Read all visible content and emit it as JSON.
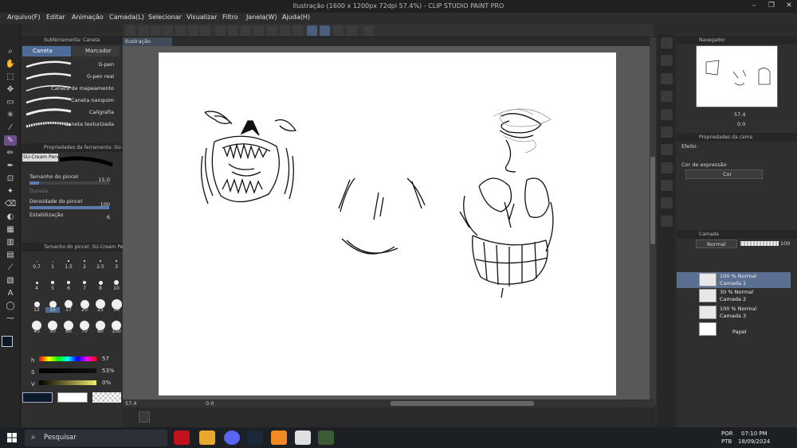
{
  "window": {
    "title": "Ilustração (1600 x 1200px 72dpi 57.4%) - CLIP STUDIO PAINT PRO"
  },
  "menu": [
    "Arquivo(F)",
    "Editar",
    "Animação",
    "Camada(L)",
    "Selecionar",
    "Visualizar",
    "Filtro",
    "Janela(W)",
    "Ajuda(H)"
  ],
  "subtool": {
    "header": "Subferramenta: Caneta",
    "tabs": [
      "Caneta",
      "Marcador"
    ],
    "brushes": [
      "G-pen",
      "G-pen real",
      "Caneta de mapeamento",
      "Caneta nanquim",
      "Caligrafia",
      "Caneta texturizada"
    ]
  },
  "toolprops": {
    "header": "Propriedades da ferramenta: SU-C...",
    "brush_name": "SU-Cream Pencil",
    "size_label": "Tamanho do pincel",
    "size_value": "15.0",
    "hardness_label": "Dureza",
    "density_label": "Densidade do pincel",
    "density_value": "100",
    "stabilization_label": "Estabilização",
    "stabilization_value": "6"
  },
  "brushsize": {
    "header": "Tamanho do pincel: SU-Cream Penci",
    "row1": [
      "0.7",
      "1",
      "1.5",
      "2",
      "2.5",
      "3"
    ],
    "row2": [
      "4",
      "5",
      "6",
      "7",
      "8",
      "10"
    ],
    "row3": [
      "12",
      "15",
      "17",
      "20",
      "25",
      "30"
    ],
    "row4": [
      "40",
      "50",
      "60",
      "70",
      "80",
      "100"
    ],
    "selected": "15"
  },
  "color": {
    "h_label": "h",
    "h_value": "57",
    "s_label": "S",
    "s_value": "53%",
    "v_label": "V",
    "v_value": "0%",
    "mode_tabs": "HSV",
    "main_color": "#0b1a2b",
    "sub_color": "#ffffff"
  },
  "doc_tab": "Ilustração",
  "status": {
    "zoom": "57.4",
    "angle": "0.0"
  },
  "navigator": {
    "header": "Navegador",
    "zoom": "57.4",
    "angle": "0.0"
  },
  "layerprops": {
    "header": "Propriedades da cama",
    "effect_label": "Efeito",
    "expression_label": "Cor de expressão",
    "expression_value": "Cor"
  },
  "layers": {
    "header": "Camada",
    "blend_mode": "Normal",
    "opacity": "100",
    "items": [
      {
        "line1": "100 % Normal",
        "line2": "Camada 1"
      },
      {
        "line1": "30 % Normal",
        "line2": "Camada 2"
      },
      {
        "line1": "100 % Normal",
        "line2": "Camada 3"
      },
      {
        "line1": "",
        "line2": "Papel"
      }
    ]
  },
  "taskbar": {
    "search_placeholder": "Pesquisar",
    "lang1": "POR",
    "lang2": "PTB",
    "time": "07:10 PM",
    "date": "18/09/2024"
  }
}
